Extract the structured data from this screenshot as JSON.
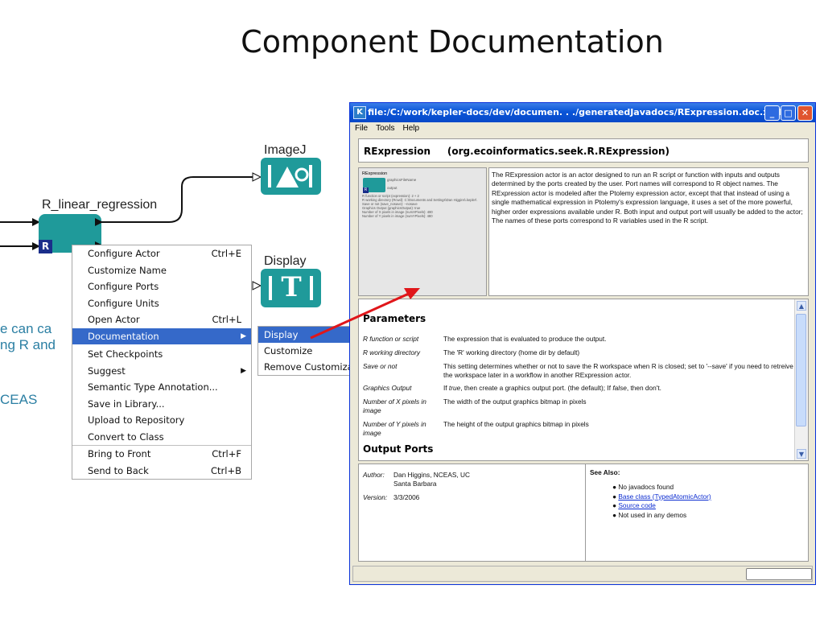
{
  "slide": {
    "title": "Component Documentation"
  },
  "canvas": {
    "actor_r_label": "R_linear_regression",
    "actor_r_badge": "R",
    "imagej_label": "ImageJ",
    "display_label": "Display",
    "display_icon_glyph": "T",
    "side_texts": [
      "e can ca",
      "ng R and",
      "CEAS"
    ]
  },
  "context_menu": {
    "items": [
      {
        "label": "Configure Actor",
        "shortcut": "Ctrl+E"
      },
      {
        "label": "Customize Name",
        "shortcut": ""
      },
      {
        "label": "Configure Ports",
        "shortcut": ""
      },
      {
        "label": "Configure Units",
        "shortcut": ""
      },
      {
        "label": "Open Actor",
        "shortcut": "Ctrl+L"
      },
      {
        "label": "Documentation",
        "shortcut": "",
        "submenu": true,
        "selected": true
      },
      {
        "label": "Set Checkpoints",
        "shortcut": ""
      },
      {
        "label": "Suggest",
        "shortcut": "",
        "submenu": true
      },
      {
        "label": "Semantic Type Annotation...",
        "shortcut": ""
      },
      {
        "label": "Save in Library...",
        "shortcut": ""
      },
      {
        "label": "Upload to Repository",
        "shortcut": ""
      },
      {
        "label": "Convert to Class",
        "shortcut": ""
      },
      {
        "label": "Bring to Front",
        "shortcut": "Ctrl+F"
      },
      {
        "label": "Send to Back",
        "shortcut": "Ctrl+B"
      }
    ],
    "submenu": [
      "Display",
      "Customize",
      "Remove Customization"
    ]
  },
  "doc_window": {
    "title": "file:/C:/work/kepler-docs/dev/documen. . ./generatedJavadocs/RExpression.doc.xml",
    "menu": [
      "File",
      "Tools",
      "Help"
    ],
    "actor_name": "RExpression",
    "actor_class": "(org.ecoinformatics.seek.R.RExpression)",
    "description": "The RExpression actor is an actor designed to run an R script or function with inputs and outputs determined by the ports created by the user. Port names will correspond to R object names. The RExpression actor is modeled after the Ptolemy expression actor, except that that instead of using a single mathematical expression in Ptolemy's expression language, it uses a set of the more powerful, higher order expressions available under R. Both input and output port will usually be added to the actor; The names of these ports correspond to R variables used in the R script.",
    "thumbnail": {
      "title": "RExpression",
      "port1": "graphicsFileName",
      "port2": "output",
      "badge": "R",
      "lines": [
        "R function or script (expression): 2 + 2",
        "R working directory (Rcwd): C:\\Documents and Settings\\Dan Higgins\\.kepler\\",
        "Save or not (save_nosave): --nosave",
        "Graphics Output (graphicsOutput): true",
        "Number of X pixels in image (numXPixels): 480",
        "Number of Y pixels in image (numYPixels): 480"
      ]
    },
    "parameters_title": "Parameters",
    "parameters": [
      {
        "name": "R function or script",
        "desc": "The expression that is evaluated to produce the output."
      },
      {
        "name": "R working directory",
        "desc": "The 'R' working directory (home dir by default)"
      },
      {
        "name": "Save or not",
        "desc": "This setting determines whether or not to save the R workspace when R is closed; set to '--save' if you need to retreive the workspace later in a workflow in another RExpression actor."
      },
      {
        "name": "Graphics Output",
        "desc_prefix": "If ",
        "desc_true": "true",
        "desc_mid": ", then create a graphics output port. (the default); If ",
        "desc_false": "false",
        "desc_suffix": ", then don't."
      },
      {
        "name": "Number of X pixels in image",
        "desc": "The width of the output graphics bitmap in pixels"
      },
      {
        "name": "Number of Y pixels in image",
        "desc": "The height of the output graphics bitmap in pixels"
      }
    ],
    "output_ports_title": "Output Ports",
    "author_label": "Author:",
    "author_value": "Dan Higgins, NCEAS, UC Santa Barbara",
    "version_label": "Version:",
    "version_value": "3/3/2006",
    "see_also_title": "See Also:",
    "see_also": [
      {
        "text": "No javadocs found",
        "link": false
      },
      {
        "text": "Base class (TypedAtomicActor)",
        "link": true
      },
      {
        "text": "Source code",
        "link": true
      },
      {
        "text": "Not used in any demos",
        "link": false
      }
    ]
  },
  "colors": {
    "actor_teal": "#1f9a9a",
    "menu_highlight": "#3569c9",
    "arrow_red": "#e0161a",
    "link_blue": "#0a2bd0",
    "xp_title_blue": "#0a55d8"
  }
}
